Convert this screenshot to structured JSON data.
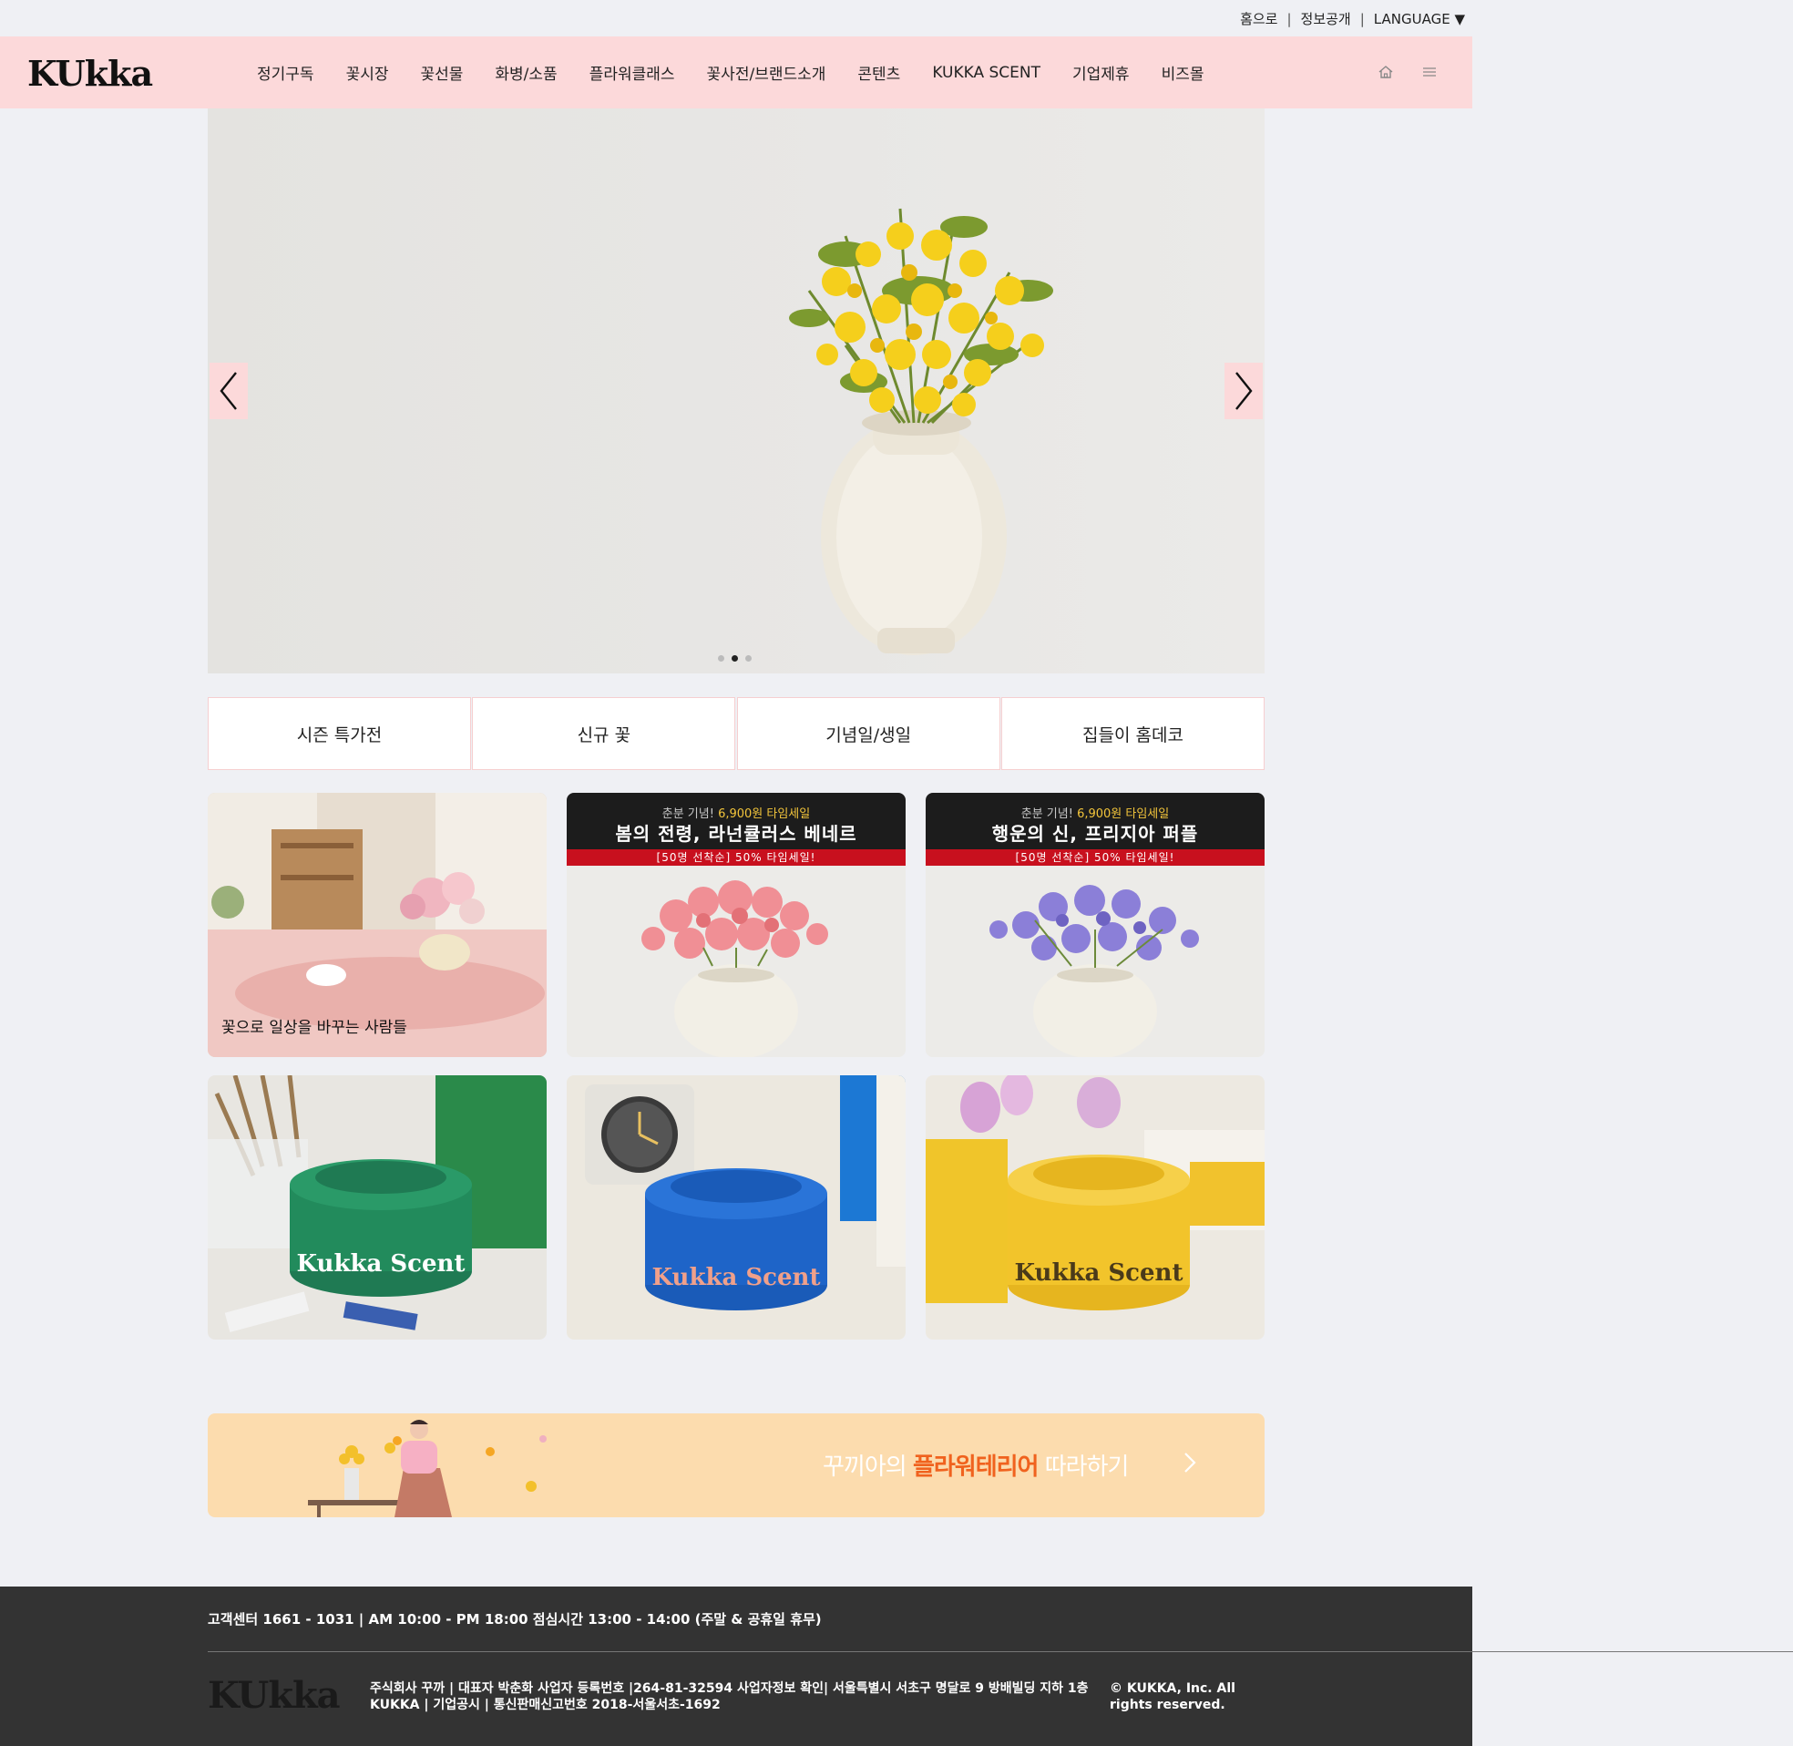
{
  "util": {
    "home_link": "홈으로",
    "sep": "|",
    "info_link": "정보공개",
    "language": "LANGUAGE ▼"
  },
  "header": {
    "logo": "KUkka",
    "nav": [
      "정기구독",
      "꽃시장",
      "꽃선물",
      "화병/소품",
      "플라워클래스",
      "꽃사전/브랜드소개",
      "콘텐츠",
      "KUKKA SCENT",
      "기업제휴",
      "비즈몰"
    ],
    "icons": [
      "home-icon",
      "menu-icon"
    ]
  },
  "hero": {
    "dots": 3,
    "active_dot": 1
  },
  "categories": [
    "시즌 특가전",
    "신규 꽃",
    "기념일/생일",
    "집들이 홈데코"
  ],
  "cards": {
    "card1_label": "꽃으로 일상을 바꾸는 사람들",
    "promo1": {
      "top_prefix": "춘분 기념! ",
      "top_highlight": "6,900원 타임세일",
      "title": "봄의 전령, 라넌큘러스 베네르",
      "bar": "[50명 선착순] 50% 타임세일!"
    },
    "promo2": {
      "top_prefix": "춘분 기념! ",
      "top_highlight": "6,900원 타임세일",
      "title": "행운의 신, 프리지아 퍼플",
      "bar": "[50명 선착순] 50% 타임세일!"
    }
  },
  "banner": {
    "prefix": "꾸끼아의 ",
    "accent": "플라워테리어",
    "suffix": " 따라하기"
  },
  "footer": {
    "contact": "고객센터 1661 - 1031   |   AM 10:00 - PM 18:00 점심시간 13:00 - 14:00 (주말 & 공휴일 휴무)",
    "logo": "KUkka",
    "info_line1": "주식회사 꾸까 | 대표자 박춘화 사업자 등록번호 |264-81-32594 사업자정보 확인| 서울특별시 서초구 명달로 9 방배빌딩 지하 1층",
    "info_line2": "KUKKA | 기업공시 | 통신판매신고번호 2018-서울서초-1692",
    "copyright": "© KUKKA, Inc. All rights reserved."
  },
  "colors": {
    "header_pink": "#fcd9da",
    "banner_peach": "#fcdcae",
    "banner_accent": "#f0621e",
    "promo_red": "#c8101e",
    "footer_bg": "#333333"
  }
}
